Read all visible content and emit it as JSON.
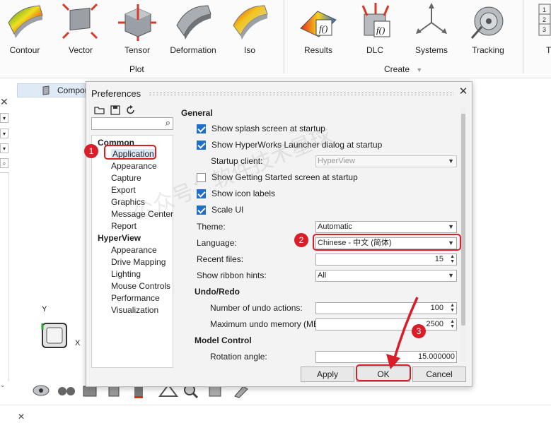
{
  "ribbon": {
    "plot_group": {
      "label": "Plot",
      "buttons": [
        {
          "label": "Contour",
          "icon": "contour-icon"
        },
        {
          "label": "Vector",
          "icon": "vector-icon"
        },
        {
          "label": "Tensor",
          "icon": "tensor-icon"
        },
        {
          "label": "Deformation",
          "icon": "deformation-icon"
        },
        {
          "label": "Iso",
          "icon": "iso-icon"
        }
      ]
    },
    "create_group": {
      "label": "Create",
      "buttons": [
        {
          "label": "Results",
          "icon": "results-icon"
        },
        {
          "label": "DLC",
          "icon": "dlc-icon"
        },
        {
          "label": "Systems",
          "icon": "systems-icon"
        },
        {
          "label": "Tracking",
          "icon": "tracking-icon"
        }
      ]
    },
    "partial_label": "T"
  },
  "left_panel": {
    "component_tab": "Compone"
  },
  "axis": {
    "y": "Y",
    "x": "X"
  },
  "dialog": {
    "title": "Preferences",
    "toolbar_icons": [
      "open-folder-icon",
      "save-icon",
      "refresh-icon"
    ],
    "search_placeholder": "",
    "tree": {
      "groups": [
        {
          "name": "Common",
          "items": [
            "Application",
            "Appearance",
            "Capture",
            "Export",
            "Graphics",
            "Message Center",
            "Report"
          ]
        },
        {
          "name": "HyperView",
          "items": [
            "Appearance",
            "Drive Mapping",
            "Lighting",
            "Mouse Controls",
            "Performance",
            "Visualization"
          ]
        }
      ],
      "selected": "Application"
    },
    "general": {
      "title": "General",
      "show_splash": {
        "label": "Show splash screen at startup",
        "checked": true
      },
      "show_launcher": {
        "label": "Show HyperWorks Launcher dialog at startup",
        "checked": true
      },
      "startup_client": {
        "label": "Startup client:",
        "value": "HyperView"
      },
      "show_getting_started": {
        "label": "Show Getting Started screen at startup",
        "checked": false
      },
      "show_icon_labels": {
        "label": "Show icon labels",
        "checked": true
      },
      "scale_ui": {
        "label": "Scale UI",
        "checked": true
      },
      "theme": {
        "label": "Theme:",
        "value": "Automatic"
      },
      "language": {
        "label": "Language:",
        "value": "Chinese - 中文 (简体)"
      },
      "recent_files": {
        "label": "Recent files:",
        "value": "15"
      },
      "ribbon_hints": {
        "label": "Show ribbon hints:",
        "value": "All"
      }
    },
    "undo": {
      "title": "Undo/Redo",
      "actions": {
        "label": "Number of undo actions:",
        "value": "100"
      },
      "memory": {
        "label": "Maximum undo memory (MB):",
        "value": "2500"
      }
    },
    "model_control": {
      "title": "Model Control",
      "rotation": {
        "label": "Rotation angle:",
        "value": "15.000000"
      }
    },
    "buttons": {
      "apply": "Apply",
      "ok": "OK",
      "cancel": "Cancel"
    }
  },
  "annotations": {
    "step1": "1",
    "step2": "2",
    "step3": "3",
    "arrow_color": "#d91e2a"
  },
  "watermark": "公众号：软件技术星球"
}
